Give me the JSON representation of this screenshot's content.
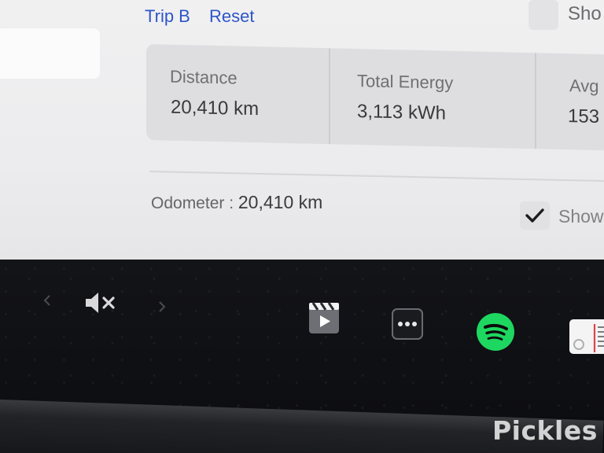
{
  "trip": {
    "trip_b_label": "Trip B",
    "reset_label": "Reset",
    "show_label_top": "Sho"
  },
  "stats": {
    "distance_label": "Distance",
    "distance_value": "20,410 km",
    "energy_label": "Total Energy",
    "energy_value": "3,113 kWh",
    "avg_label": "Avg",
    "avg_value": "153"
  },
  "odometer": {
    "label": "Odometer :",
    "value": "20,410 km"
  },
  "show_option": {
    "label": "Show",
    "checked": true
  },
  "dock": {
    "icons": [
      "chevron-left-icon",
      "volume-muted-icon",
      "chevron-right-icon",
      "theater-icon",
      "more-apps-icon",
      "spotify-icon",
      "calendar-icon"
    ]
  },
  "watermark": {
    "text": "Pickles"
  },
  "colors": {
    "link_blue": "#2f56c9",
    "spotify_green": "#1ed760",
    "card_bg": "#dedee0"
  }
}
